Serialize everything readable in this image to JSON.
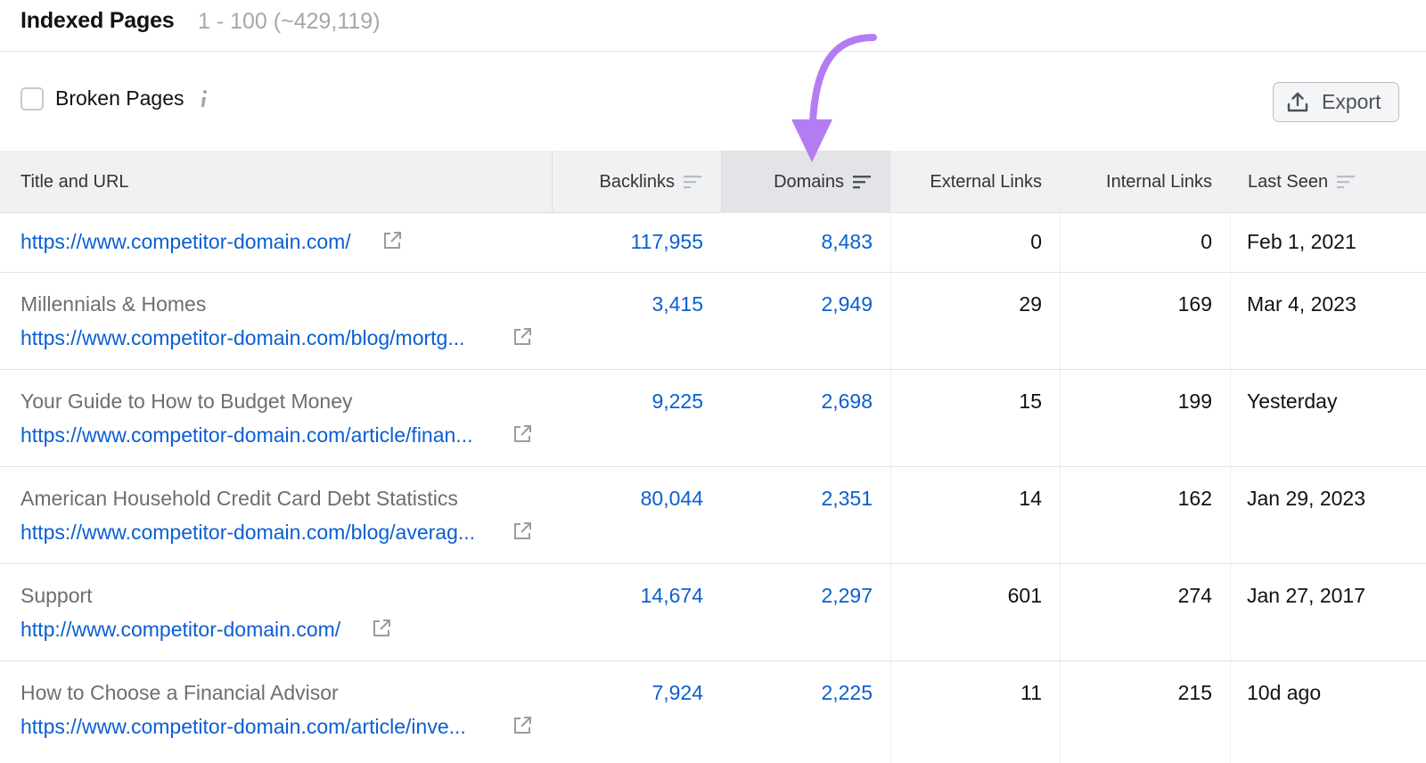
{
  "header": {
    "title": "Indexed Pages",
    "count": "1 - 100 (~429,119)"
  },
  "filters": {
    "broken_pages_label": "Broken Pages",
    "broken_pages_checked": false,
    "info_icon": "info-icon"
  },
  "toolbar": {
    "export_label": "Export",
    "export_icon": "upload-icon"
  },
  "table": {
    "columns": [
      {
        "label": "Title and URL"
      },
      {
        "label": "Backlinks"
      },
      {
        "label": "Domains"
      },
      {
        "label": "External Links"
      },
      {
        "label": "Internal Links"
      },
      {
        "label": "Last Seen"
      }
    ],
    "sorted_column": "Domains",
    "rows": [
      {
        "title": "",
        "url": "https://www.competitor-domain.com/",
        "backlinks": "117,955",
        "domains": "8,483",
        "external": "0",
        "internal": "0",
        "last_seen": "Feb 1, 2021"
      },
      {
        "title": "Millennials & Homes",
        "url": "https://www.competitor-domain.com/blog/mortg...",
        "backlinks": "3,415",
        "domains": "2,949",
        "external": "29",
        "internal": "169",
        "last_seen": "Mar 4, 2023"
      },
      {
        "title": "Your Guide to How to Budget Money",
        "url": "https://www.competitor-domain.com/article/finan...",
        "backlinks": "9,225",
        "domains": "2,698",
        "external": "15",
        "internal": "199",
        "last_seen": "Yesterday"
      },
      {
        "title": "American Household Credit Card Debt Statistics",
        "url": "https://www.competitor-domain.com/blog/averag...",
        "backlinks": "80,044",
        "domains": "2,351",
        "external": "14",
        "internal": "162",
        "last_seen": "Jan 29, 2023"
      },
      {
        "title": "Support",
        "url": "http://www.competitor-domain.com/",
        "backlinks": "14,674",
        "domains": "2,297",
        "external": "601",
        "internal": "274",
        "last_seen": "Jan 27, 2017"
      },
      {
        "title": "How to Choose a Financial Advisor",
        "url": "https://www.competitor-domain.com/article/inve...",
        "backlinks": "7,924",
        "domains": "2,225",
        "external": "11",
        "internal": "215",
        "last_seen": "10d ago"
      }
    ]
  },
  "colors": {
    "link": "#0b5fd1",
    "annotation_arrow": "#b47cf2",
    "header_bg": "#f0f1f3",
    "sorted_header_bg": "#e3e4e7"
  }
}
